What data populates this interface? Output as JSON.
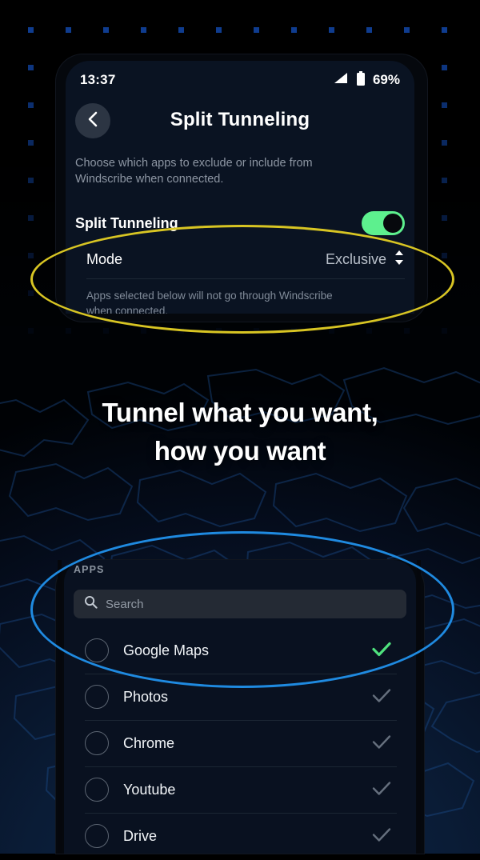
{
  "app": {
    "store_headline_line1": "Tunnel what you want,",
    "store_headline_line2": "how you want"
  },
  "status_bar": {
    "time": "13:37",
    "battery_percent": "69%",
    "signal_icon": "signal-bars-icon",
    "battery_icon": "battery-icon"
  },
  "header": {
    "back_icon": "chevron-left-icon",
    "title": "Split Tunneling"
  },
  "settings": {
    "subtitle": "Choose which apps to exclude or include from Windscribe when connected.",
    "toggle_row": {
      "label": "Split Tunneling",
      "enabled": true,
      "toggle_color": "#5df08e"
    },
    "mode_row": {
      "label": "Mode",
      "value": "Exclusive",
      "stepper_icon": "chevron-up-down-icon"
    },
    "hint": "Apps selected below will not go through Windscribe when connected."
  },
  "apps_panel": {
    "section_label": "APPS",
    "search": {
      "icon": "search-icon",
      "placeholder": "Search",
      "value": ""
    },
    "items": [
      {
        "name": "Google Maps",
        "radio_icon": "radio-unchecked-icon",
        "check_icon": "check-icon",
        "checked": true
      },
      {
        "name": "Photos",
        "radio_icon": "radio-unchecked-icon",
        "check_icon": "check-icon",
        "checked": false
      },
      {
        "name": "Chrome",
        "radio_icon": "radio-unchecked-icon",
        "check_icon": "check-icon",
        "checked": false
      },
      {
        "name": "Youtube",
        "radio_icon": "radio-unchecked-icon",
        "check_icon": "check-icon",
        "checked": false
      },
      {
        "name": "Drive",
        "radio_icon": "radio-unchecked-icon",
        "check_icon": "check-icon",
        "checked": false
      }
    ]
  },
  "annotations": {
    "highlight_mode_color": "#d8c523",
    "highlight_apps_color": "#1f8ae0"
  },
  "theme": {
    "accent_green": "#5df08e",
    "check_active": "#4fe27e",
    "check_inactive": "#656f7d",
    "dot_blue": "#10419b",
    "background_dark": "#000000",
    "background_navy": "#0c2a52"
  }
}
